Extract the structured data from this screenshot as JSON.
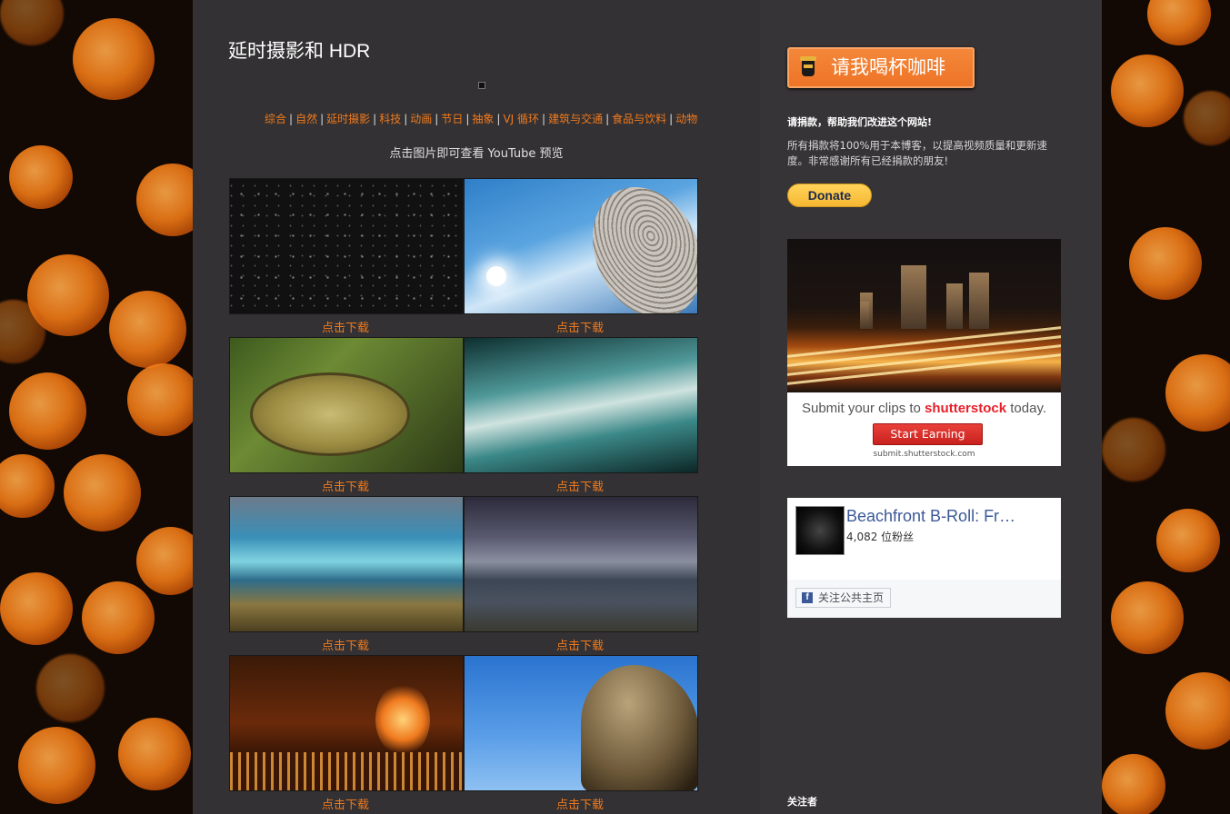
{
  "post": {
    "title": "延时摄影和 HDR",
    "preview_note": "点击图片即可查看 YouTube 预览"
  },
  "categories": [
    "综合",
    "自然",
    "延时摄影",
    "科技",
    "动画",
    "节日",
    "抽象",
    "VJ 循环",
    "建筑与交通",
    "食品与饮料",
    "动物"
  ],
  "separator": "|",
  "gallery": {
    "download_label": "点击下载",
    "rows": [
      [
        "starry-night",
        "satellite-dish"
      ],
      [
        "sundial",
        "flowing-water"
      ],
      [
        "waterfall",
        "stormy-sea"
      ],
      [
        "city-fire",
        "angel-statue"
      ]
    ]
  },
  "sidebar": {
    "coffee_button": "请我喝杯咖啡",
    "donate_heading": "请捐款，帮助我们改进这个网站!",
    "donate_text": "所有捐款将100%用于本博客，以提高视频质量和更新速度。非常感谢所有已经捐款的朋友!",
    "donate_button": "Donate",
    "ad": {
      "text_before": "Submit your clips to ",
      "brand": "shutterstock",
      "text_after": " today.",
      "cta": "Start Earning",
      "url": "submit.shutterstock.com"
    },
    "facebook": {
      "page_name": "Beachfront B-Roll: Fr…",
      "fans": "4,082 位粉丝",
      "follow_button": "关注公共主页",
      "brand_colour": "#3b5998"
    },
    "followers_heading": "关注者"
  },
  "colors": {
    "accent": "#f07a1e",
    "content_bg": "#333133",
    "sidebar_bg": "#363436"
  }
}
